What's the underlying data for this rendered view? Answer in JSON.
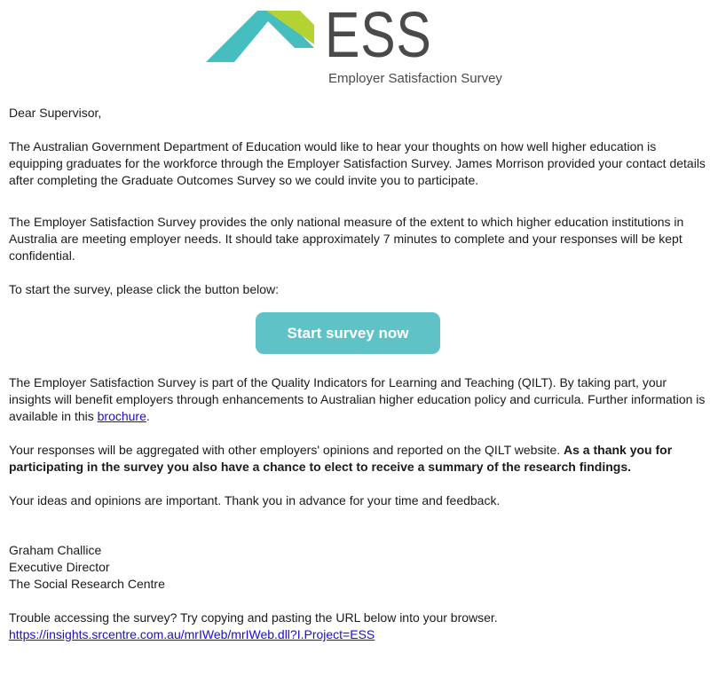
{
  "logo": {
    "letters": "ESS",
    "subtitle": "Employer Satisfaction Survey",
    "colors": {
      "teal": "#46bdbf",
      "lime": "#b3d334",
      "text": "#4a4a4a"
    }
  },
  "email": {
    "greeting": "Dear Supervisor,",
    "para1": "The Australian Government Department of Education would like to hear your thoughts on how well higher education is equipping graduates for the workforce through the Employer Satisfaction Survey. James Morrison provided your contact details after completing the Graduate Outcomes Survey so we could invite you to participate.",
    "para2": "The Employer Satisfaction Survey provides the only national measure of the extent to which higher education institutions in Australia are meeting employer needs. It should take approximately 7 minutes to complete and your responses will be kept confidential.",
    "para3": "To start the survey, please click the button below:",
    "cta_label": "Start survey now",
    "cta_color": "#5ec2c6",
    "para4_before_link": "The Employer Satisfaction Survey is part of the Quality Indicators for Learning and Teaching (QILT). By taking part, your insights will benefit employers through enhancements to Australian higher education policy and curricula. Further information is available in this ",
    "para4_link": "brochure",
    "para4_after_link": ".",
    "para5_plain": "Your responses will be aggregated with other employers' opinions and reported on the QILT website. ",
    "para5_bold": "As a thank you for participating in the survey you also have a chance to elect to receive a summary of the research findings.",
    "para6": "Your ideas and opinions are important. Thank you in advance for your time and feedback.",
    "signature": {
      "name": "Graham Challice",
      "title": "Executive Director",
      "org": "The Social Research Centre"
    },
    "trouble_text": "Trouble accessing the survey? Try copying and pasting the URL below into your browser.",
    "survey_url": "https://insights.srcentre.com.au/mrIWeb/mrIWeb.dll?I.Project=ESS",
    "link_color": "#1a0dcc"
  }
}
